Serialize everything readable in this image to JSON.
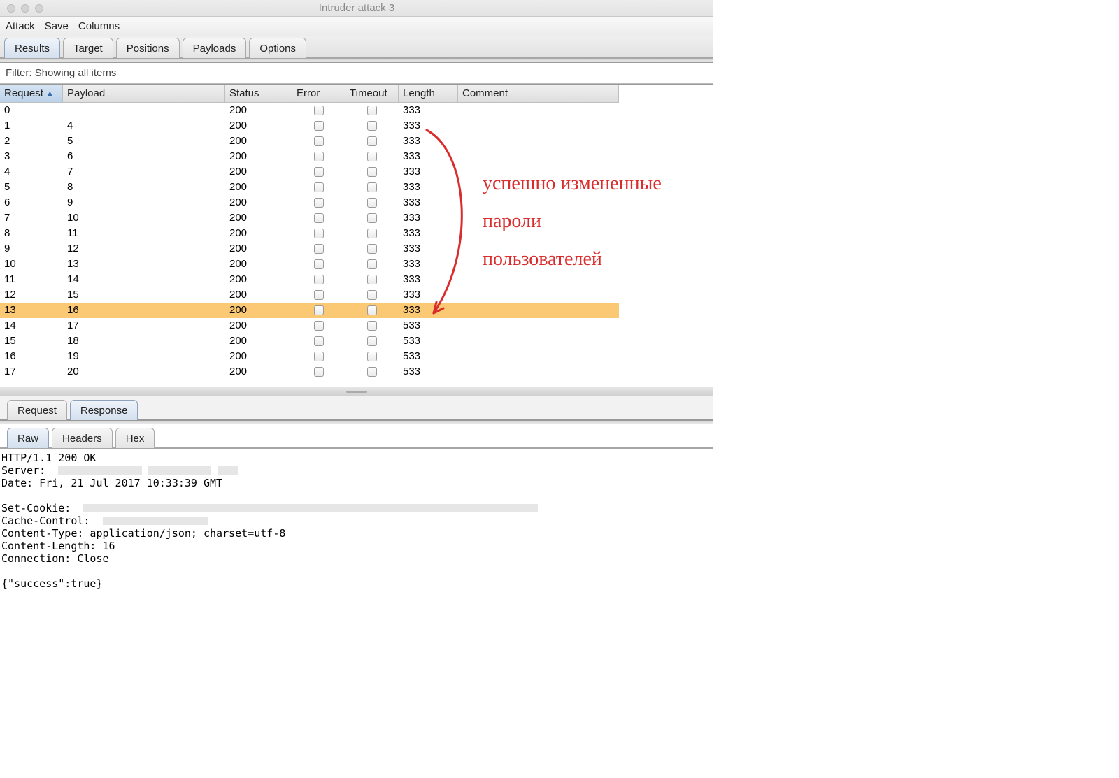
{
  "window": {
    "title": "Intruder attack 3"
  },
  "menubar": {
    "items": [
      "Attack",
      "Save",
      "Columns"
    ]
  },
  "main_tabs": {
    "items": [
      "Results",
      "Target",
      "Positions",
      "Payloads",
      "Options"
    ],
    "active": 0
  },
  "filter": {
    "text": "Filter: Showing all items"
  },
  "table": {
    "columns": [
      "Request",
      "Payload",
      "Status",
      "Error",
      "Timeout",
      "Length",
      "Comment"
    ],
    "sorted_col": 0,
    "highlight_row": 13,
    "rows": [
      {
        "request": "0",
        "payload": "",
        "status": "200",
        "length": "333"
      },
      {
        "request": "1",
        "payload": "4",
        "status": "200",
        "length": "333"
      },
      {
        "request": "2",
        "payload": "5",
        "status": "200",
        "length": "333"
      },
      {
        "request": "3",
        "payload": "6",
        "status": "200",
        "length": "333"
      },
      {
        "request": "4",
        "payload": "7",
        "status": "200",
        "length": "333"
      },
      {
        "request": "5",
        "payload": "8",
        "status": "200",
        "length": "333"
      },
      {
        "request": "6",
        "payload": "9",
        "status": "200",
        "length": "333"
      },
      {
        "request": "7",
        "payload": "10",
        "status": "200",
        "length": "333"
      },
      {
        "request": "8",
        "payload": "11",
        "status": "200",
        "length": "333"
      },
      {
        "request": "9",
        "payload": "12",
        "status": "200",
        "length": "333"
      },
      {
        "request": "10",
        "payload": "13",
        "status": "200",
        "length": "333"
      },
      {
        "request": "11",
        "payload": "14",
        "status": "200",
        "length": "333"
      },
      {
        "request": "12",
        "payload": "15",
        "status": "200",
        "length": "333"
      },
      {
        "request": "13",
        "payload": "16",
        "status": "200",
        "length": "333"
      },
      {
        "request": "14",
        "payload": "17",
        "status": "200",
        "length": "533"
      },
      {
        "request": "15",
        "payload": "18",
        "status": "200",
        "length": "533"
      },
      {
        "request": "16",
        "payload": "19",
        "status": "200",
        "length": "533"
      },
      {
        "request": "17",
        "payload": "20",
        "status": "200",
        "length": "533"
      }
    ]
  },
  "lower_tabs": {
    "items": [
      "Request",
      "Response"
    ],
    "active": 1
  },
  "view_tabs": {
    "items": [
      "Raw",
      "Headers",
      "Hex"
    ],
    "active": 0
  },
  "response": {
    "lines": [
      "HTTP/1.1 200 OK",
      "Server: ",
      "Date: Fri, 21 Jul 2017 10:33:39 GMT",
      "",
      "Set-Cookie: ",
      "Cache-Control: ",
      "Content-Type: application/json; charset=utf-8",
      "Content-Length: 16",
      "Connection: Close",
      "",
      "{\"success\":true}"
    ]
  },
  "annotation": {
    "text": "успешно измененные\nпароли\nпользователей",
    "color": "#d92d2d"
  }
}
